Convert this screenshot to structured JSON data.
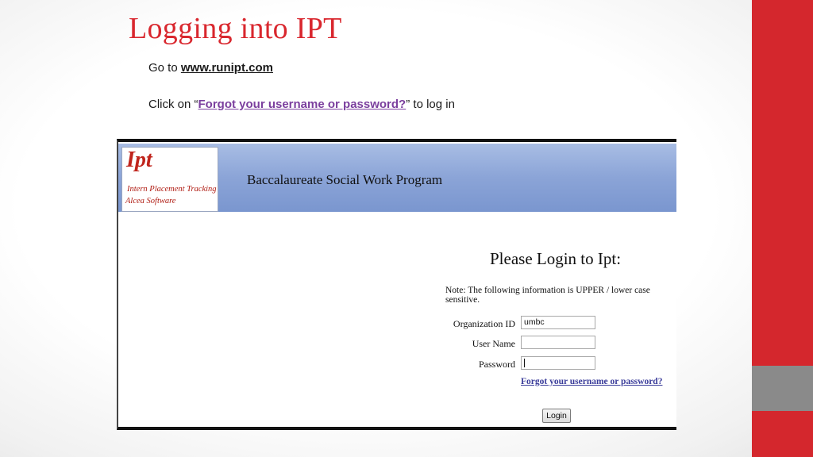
{
  "slide": {
    "title": "Logging into IPT",
    "line1": {
      "prefix": "Go to ",
      "link": "www.runipt.com"
    },
    "line2": {
      "prefix": "Click on “",
      "link": "Forgot your username or password?",
      "suffix": "” to log in"
    }
  },
  "screenshot": {
    "logo": {
      "main": "Ipt",
      "sub1": "Intern Placement Tracking",
      "sub2": "Alcea Software"
    },
    "program_title": "Baccalaureate Social Work Program",
    "login_heading": "Please Login to Ipt:",
    "note": "Note: The following information is UPPER / lower case sensitive.",
    "fields": {
      "org_label": "Organization ID",
      "org_value": "umbc",
      "user_label": "User Name",
      "user_value": "",
      "pass_label": "Password",
      "pass_value": ""
    },
    "forgot_link": "Forgot your username or password?",
    "login_button": "Login"
  },
  "colors": {
    "title_red": "#d9272e",
    "sidebar_red": "#d4272d",
    "sidebar_gray": "#8a8a8a",
    "link_purple": "#7b3f9e",
    "banner_blue": "#8ba4d7"
  }
}
